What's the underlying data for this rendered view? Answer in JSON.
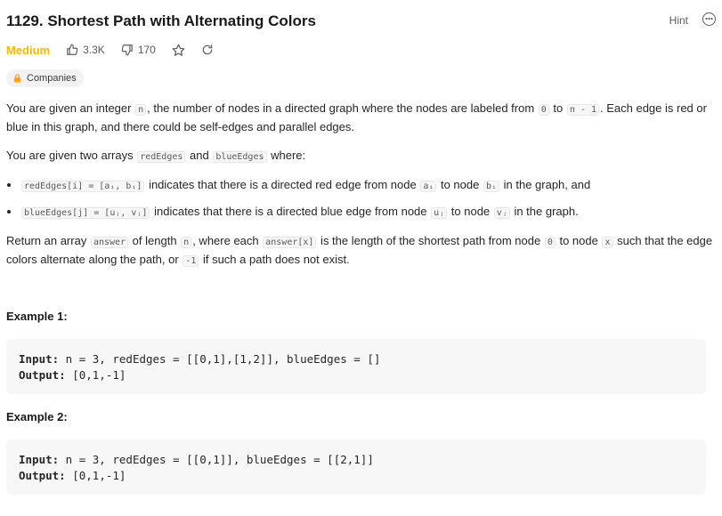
{
  "problem": {
    "title": "1129. Shortest Path with Alternating Colors",
    "hint_label": "Hint",
    "difficulty": "Medium",
    "likes": "3.3K",
    "dislikes": "170",
    "companies_label": "Companies"
  },
  "description": {
    "p1": {
      "a": "You are given an integer ",
      "code1": "n",
      "b": ", the number of nodes in a directed graph where the nodes are labeled from ",
      "code2": "0",
      "c": " to ",
      "code3": "n - 1",
      "d": ". Each edge is red or",
      "line2": "blue in this graph, and there could be self-edges and parallel edges."
    },
    "p2": {
      "a": "You are given two arrays ",
      "code1": "redEdges",
      "b": " and ",
      "code2": "blueEdges",
      "c": " where:"
    },
    "bullet1": {
      "code": "redEdges[i] = [aᵢ, bᵢ]",
      "a": " indicates that there is a directed red edge from node ",
      "code2": "aᵢ",
      "b": " to node ",
      "code3": "bᵢ",
      "c": " in the graph, and"
    },
    "bullet2": {
      "code": "blueEdges[j] = [uⱼ, vⱼ]",
      "a": " indicates that there is a directed blue edge from node ",
      "code2": "uⱼ",
      "b": " to node ",
      "code3": "vⱼ",
      "c": " in the graph."
    },
    "p3": {
      "a": "Return an array ",
      "code1": "answer",
      "b": " of length ",
      "code2": "n",
      "c": ", where each ",
      "code3": "answer[x]",
      "d": " is the length of the shortest path from node ",
      "code4": "0",
      "e": " to node ",
      "code5": "x",
      "f": " such that the edge",
      "g": "colors alternate along the path, or ",
      "code6": "-1",
      "h": " if such a path does not exist."
    }
  },
  "examples": [
    {
      "heading": "Example 1:",
      "input_label": "Input:",
      "input": " n = 3, redEdges = [[0,1],[1,2]], blueEdges = []",
      "output_label": "Output:",
      "output": " [0,1,-1]"
    },
    {
      "heading": "Example 2:",
      "input_label": "Input:",
      "input": " n = 3, redEdges = [[0,1]], blueEdges = [[2,1]]",
      "output_label": "Output:",
      "output": " [0,1,-1]"
    }
  ],
  "colors": {
    "difficulty_medium": "#ffb800",
    "text": "#262626",
    "code_bg": "#f7f7f8"
  }
}
